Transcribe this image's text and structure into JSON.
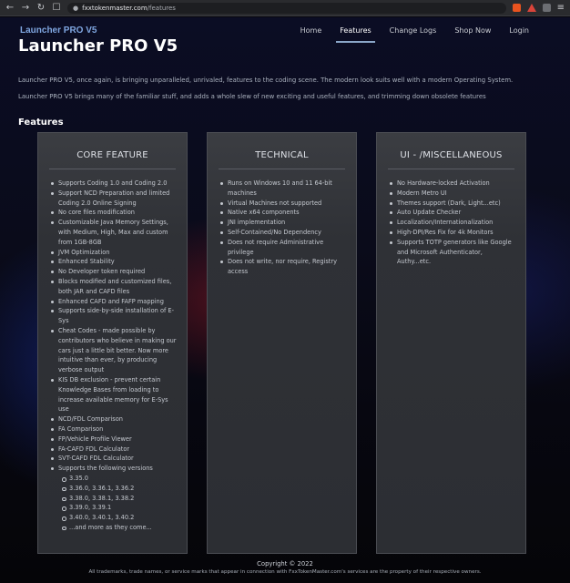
{
  "browser": {
    "url_host": "fxxtokenmaster.com",
    "url_path": "/features"
  },
  "header": {
    "brand": "Launcher PRO V5",
    "nav": [
      {
        "label": "Home",
        "active": false
      },
      {
        "label": "Features",
        "active": true
      },
      {
        "label": "Change Logs",
        "active": false
      },
      {
        "label": "Shop Now",
        "active": false
      },
      {
        "label": "Login",
        "active": false
      }
    ]
  },
  "main": {
    "title": "Launcher PRO V5",
    "intro1": "Launcher PRO V5, once again, is bringing unparalleled, unrivaled, features to the coding scene. The modern look suits well with a modern Operating System.",
    "intro2": "Launcher PRO V5 brings many of the familiar stuff, and adds a whole slew of new exciting and useful features, and trimming down obsolete features",
    "section_title": "Features"
  },
  "cards": [
    {
      "title": "CORE FEATURE",
      "items": [
        "Supports Coding 1.0 and Coding 2.0",
        "Support NCD Preparation and limited Coding 2.0 Online Signing",
        "No core files modification",
        "Customizable Java Memory Settings, with Medium, High, Max and custom from 1GB-8GB",
        "JVM Optimization",
        "Enhanced Stability",
        "No Developer token required",
        "Blocks modified and customized files, both JAR and CAFD files",
        "Enhanced CAFD and FAFP mapping",
        "Supports side-by-side installation of E-Sys",
        "Cheat Codes - made possible by contributors who believe in making our cars just a little bit better. Now more intuitive than ever, by producing verbose output",
        "KIS DB exclusion - prevent certain Knowledge Bases from loading to increase available memory for E-Sys use",
        "NCD/FDL Comparison",
        "FA Comparison",
        "FP/Vehicle Profile Viewer",
        "FA-CAFD FDL Calculator",
        "SVT-CAFD FDL Calculator",
        "Supports the following versions"
      ],
      "versions": [
        "3.35.0",
        "3.36.0, 3.36.1, 3.36.2",
        "3.38.0, 3.38.1, 3.38.2",
        "3.39.0, 3.39.1",
        "3.40.0, 3.40.1, 3.40.2",
        "...and more as they come..."
      ]
    },
    {
      "title": "TECHNICAL",
      "items": [
        "Runs on Windows 10 and 11 64-bit machines",
        "Virtual Machines not supported",
        "Native x64 components",
        "JNI implementation",
        "Self-Contained/No Dependency",
        "Does not require Administrative privilege",
        "Does not write, nor require, Registry access"
      ]
    },
    {
      "title": "UI - /MISCELLANEOUS",
      "items": [
        "No Hardware-locked Activation",
        "Modern Metro UI",
        "Themes support (Dark, Light...etc)",
        "Auto Update Checker",
        "Localization/Internationalization",
        "High-DPI/Res Fix for 4k Monitors",
        "Supports TOTP generators like Google and Microsoft Authenticator, Authy...etc."
      ]
    }
  ],
  "footer": {
    "copyright": "Copyright © 2022",
    "trademark": "All trademarks, trade names, or service marks that appear in connection with FxxTokenMaster.com's services are the property of their respective owners."
  },
  "colors": {
    "accent": "#7fa6e0",
    "card_bg": "#2f3136",
    "page_bg": "#0a0b1a"
  }
}
